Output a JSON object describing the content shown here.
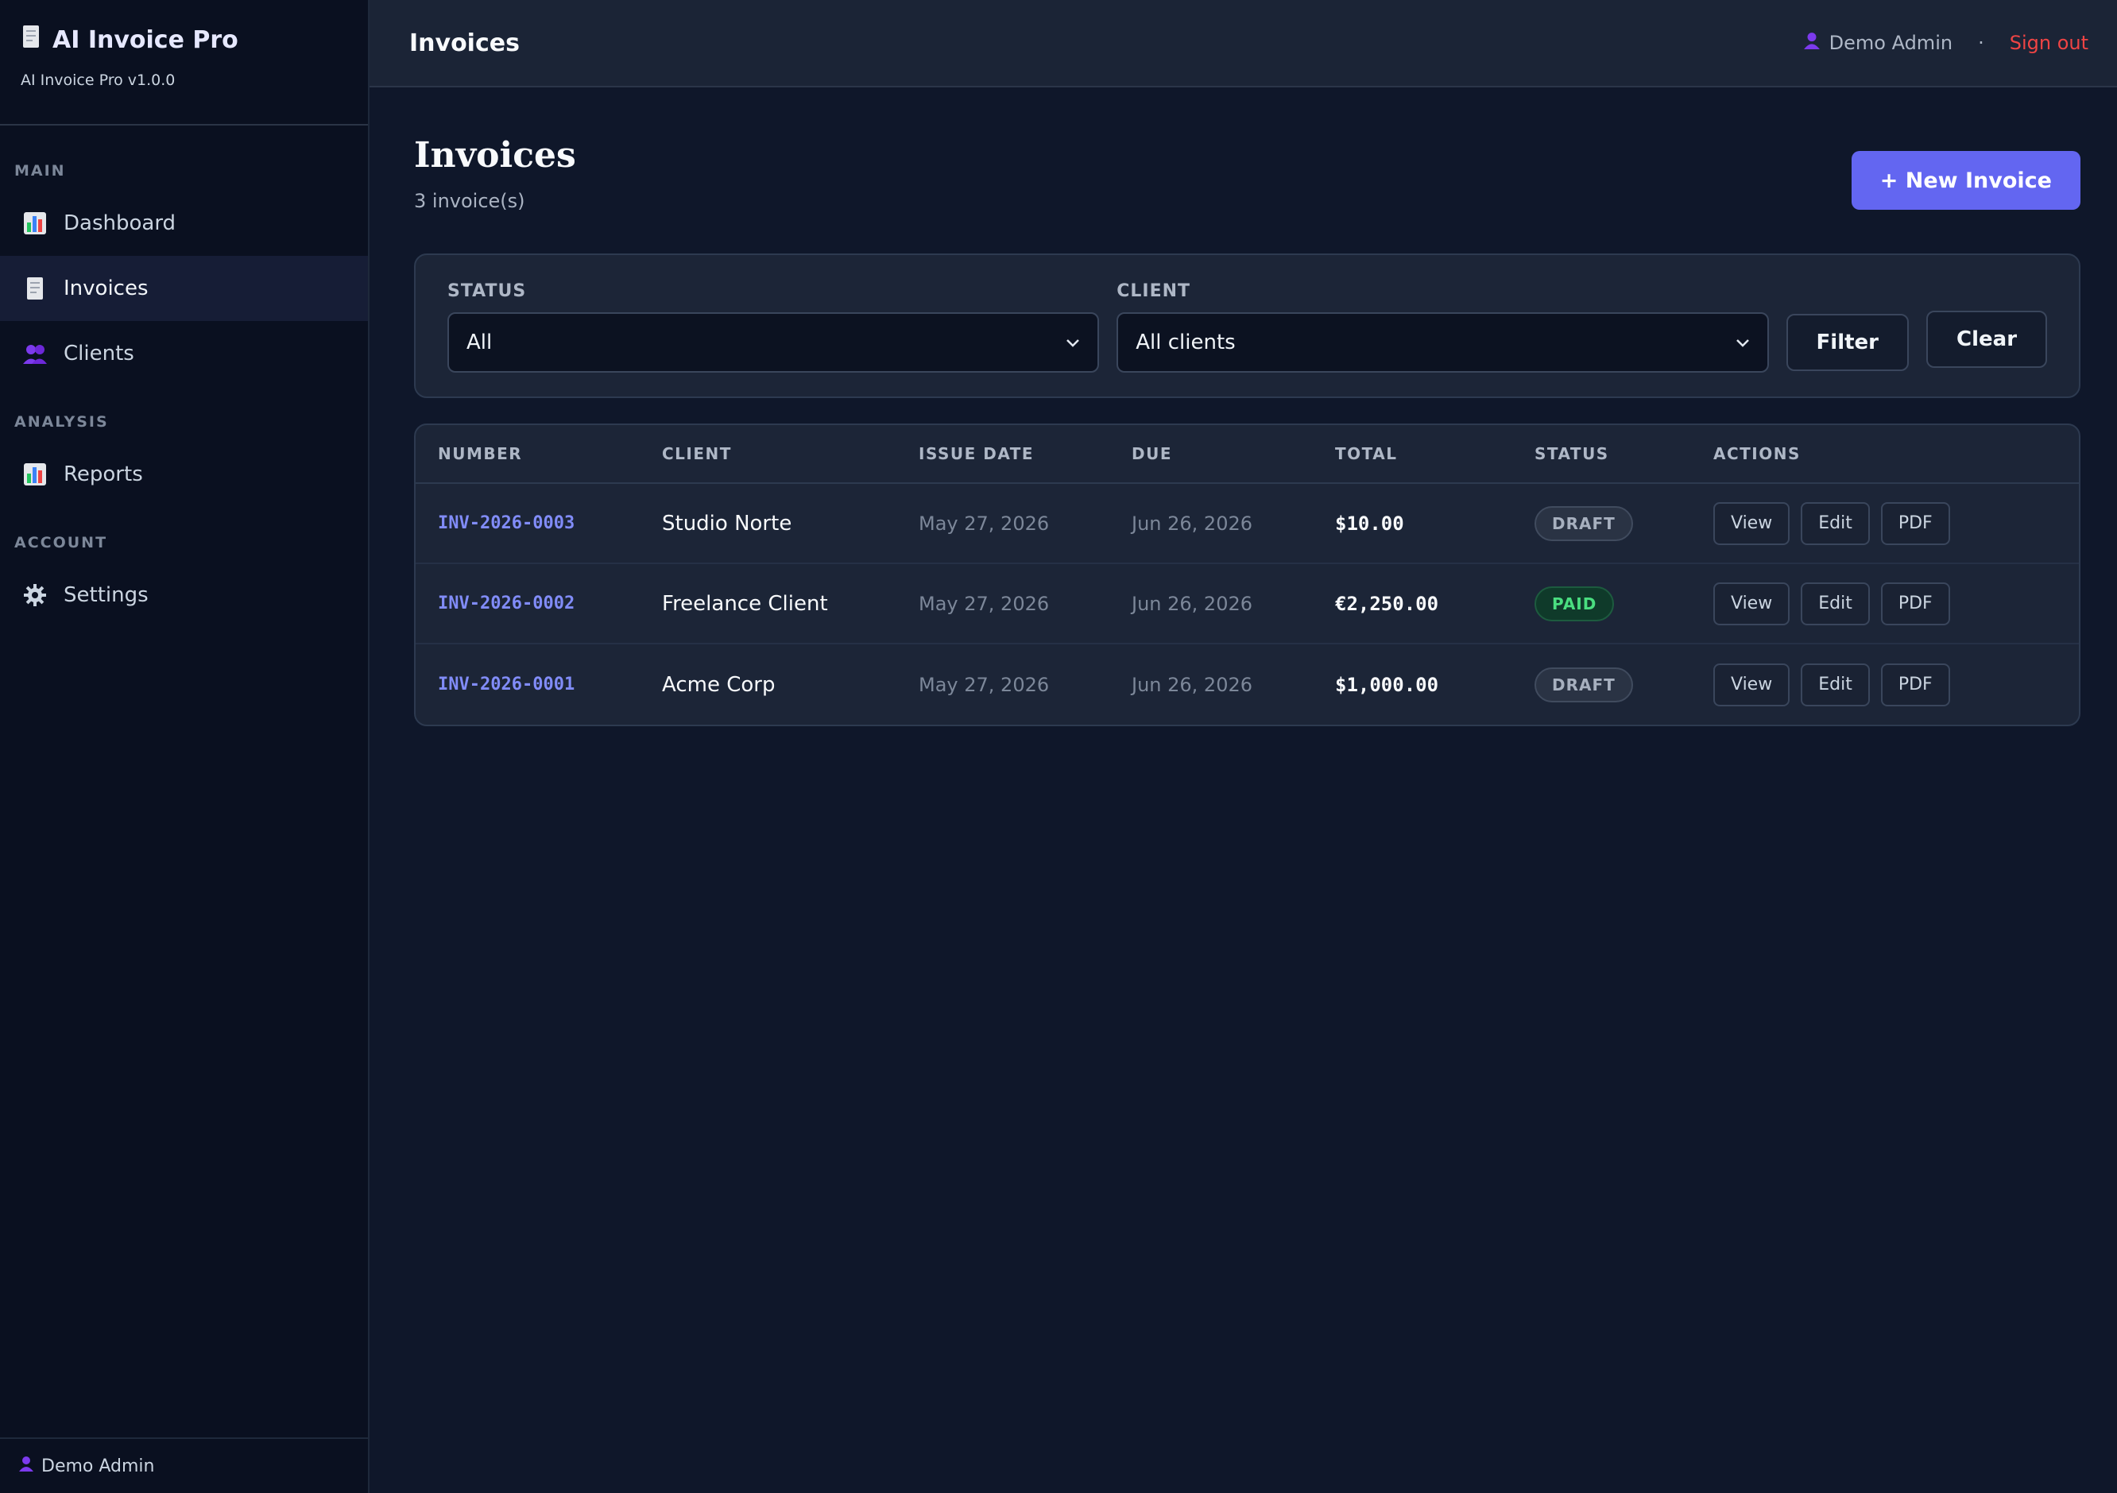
{
  "app": {
    "name": "AI Invoice Pro",
    "version": "AI Invoice Pro v1.0.0"
  },
  "sidebar": {
    "sections": [
      {
        "label": "MAIN"
      },
      {
        "label": "ANALYSIS"
      },
      {
        "label": "ACCOUNT"
      }
    ],
    "items": [
      {
        "label": "Dashboard",
        "icon": "bar-chart-icon"
      },
      {
        "label": "Invoices",
        "icon": "receipt-icon",
        "active": true
      },
      {
        "label": "Clients",
        "icon": "users-icon"
      },
      {
        "label": "Reports",
        "icon": "bar-chart-icon"
      },
      {
        "label": "Settings",
        "icon": "gear-icon"
      }
    ],
    "footer_user": "Demo Admin"
  },
  "topbar": {
    "title": "Invoices",
    "user": "Demo Admin",
    "separator": "·",
    "signout": "Sign out"
  },
  "page": {
    "title": "Invoices",
    "count": "3 invoice(s)",
    "new_button": "+ New Invoice"
  },
  "filters": {
    "status_label": "STATUS",
    "status_value": "All",
    "client_label": "CLIENT",
    "client_value": "All clients",
    "filter_button": "Filter",
    "clear_button": "Clear"
  },
  "table": {
    "headers": [
      "NUMBER",
      "CLIENT",
      "ISSUE DATE",
      "DUE",
      "TOTAL",
      "STATUS",
      "ACTIONS"
    ],
    "rows": [
      {
        "number": "INV-2026-0003",
        "client": "Studio Norte",
        "issue": "May 27, 2026",
        "due": "Jun 26, 2026",
        "total": "$10.00",
        "status": "DRAFT"
      },
      {
        "number": "INV-2026-0002",
        "client": "Freelance Client",
        "issue": "May 27, 2026",
        "due": "Jun 26, 2026",
        "total": "€2,250.00",
        "status": "PAID"
      },
      {
        "number": "INV-2026-0001",
        "client": "Acme Corp",
        "issue": "May 27, 2026",
        "due": "Jun 26, 2026",
        "total": "$1,000.00",
        "status": "DRAFT"
      }
    ],
    "actions": {
      "view": "View",
      "edit": "Edit",
      "pdf": "PDF"
    }
  },
  "colors": {
    "accent": "#6366f1",
    "link": "#818cf8",
    "danger": "#ef4444",
    "paid": "#4ade80"
  }
}
